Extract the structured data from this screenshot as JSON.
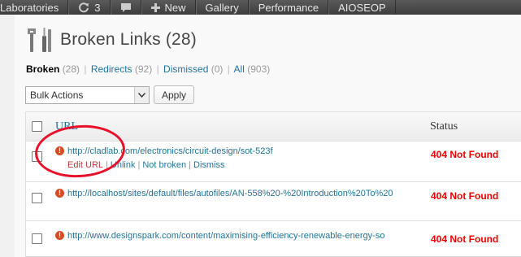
{
  "adminbar": {
    "items": [
      {
        "label": "Laboratories"
      },
      {
        "label": "3",
        "icon": "refresh-icon"
      },
      {
        "label": "",
        "icon": "comment-icon"
      },
      {
        "label": "New",
        "icon": "plus-icon"
      },
      {
        "label": "Gallery"
      },
      {
        "label": "Performance"
      },
      {
        "label": "AIOSEOP"
      }
    ]
  },
  "page": {
    "title": "Broken Links (28)",
    "icon": "tools-icon"
  },
  "filters": {
    "broken": {
      "label": "Broken",
      "count": "(28)"
    },
    "redirects": {
      "label": "Redirects",
      "count": "(92)"
    },
    "dismissed": {
      "label": "Dismissed",
      "count": "(0)"
    },
    "all": {
      "label": "All",
      "count": "(903)"
    },
    "separator": "|"
  },
  "bulk": {
    "select_value": "Bulk Actions",
    "apply_label": "Apply"
  },
  "table": {
    "columns": {
      "url": "URL",
      "status": "Status"
    },
    "rows": [
      {
        "url": "http://cladlab.com/electronics/circuit-design/sot-523f",
        "status": "404 Not Found",
        "actions": {
          "edit": "Edit URL",
          "unlink": "Unlink",
          "not_broken": "Not broken",
          "dismiss": "Dismiss",
          "separator": "|"
        }
      },
      {
        "url": "http://localhost/sites/default/files/autofiles/AN-558%20-%20Introduction%20To%20",
        "status": "404 Not Found"
      },
      {
        "url": "http://www.designspark.com/content/maximising-efficiency-renewable-energy-so",
        "status": "404 Not Found"
      }
    ]
  },
  "colors": {
    "adminbar": "#464646",
    "link": "#21759b",
    "status_error": "#ee0000",
    "annotation_circle": "#e8102a"
  }
}
